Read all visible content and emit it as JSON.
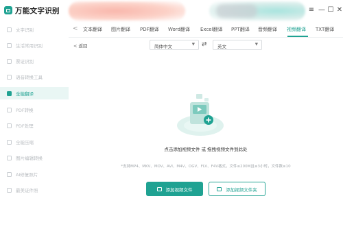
{
  "app": {
    "title": "万能文字识别"
  },
  "window_controls": {
    "menu": "≡",
    "minimize": "—",
    "maximize": "☐",
    "close": "✕"
  },
  "sidebar": {
    "items": [
      {
        "label": "文字识别",
        "icon": "text-scan-icon"
      },
      {
        "label": "生活常用识别",
        "icon": "life-icon"
      },
      {
        "label": "票证识别",
        "icon": "ticket-icon"
      },
      {
        "label": "语音转换工具",
        "icon": "voice-icon"
      },
      {
        "label": "全能翻译",
        "icon": "translate-icon",
        "active": true
      },
      {
        "label": "PDF转换",
        "icon": "pdf-convert-icon"
      },
      {
        "label": "PDF处理",
        "icon": "pdf-process-icon"
      },
      {
        "label": "全能压缩",
        "icon": "compress-icon"
      },
      {
        "label": "图片编辑转换",
        "icon": "image-edit-icon"
      },
      {
        "label": "AI修复照片",
        "icon": "ai-photo-icon"
      },
      {
        "label": "最美证件照",
        "icon": "id-photo-icon"
      }
    ]
  },
  "tabs": {
    "prev_arrow": "<",
    "items": [
      {
        "label": "文本翻译"
      },
      {
        "label": "图片翻译"
      },
      {
        "label": "PDF翻译"
      },
      {
        "label": "Word翻译"
      },
      {
        "label": "Excel翻译"
      },
      {
        "label": "PPT翻译"
      },
      {
        "label": "音频翻译"
      },
      {
        "label": "视频翻译",
        "active": true
      },
      {
        "label": "TXT翻译"
      }
    ]
  },
  "toolbar": {
    "back": "< 返回",
    "source_lang": "简体中文",
    "target_lang": "英文",
    "swap": "⇄"
  },
  "dropzone": {
    "instruction": "点击添加视频文件 或 拖拽视频文件到此处",
    "hint": "*支持MP4、MKV、MOV、AVI、M4V、OGV、FLV、F4V格式，文件≤200M且≤3小时，文件数≤10"
  },
  "buttons": {
    "add_file": "添加视频文件",
    "add_folder": "添加视频文件夹"
  },
  "colors": {
    "accent": "#1fa292",
    "active_bg": "#e9f6f4"
  }
}
